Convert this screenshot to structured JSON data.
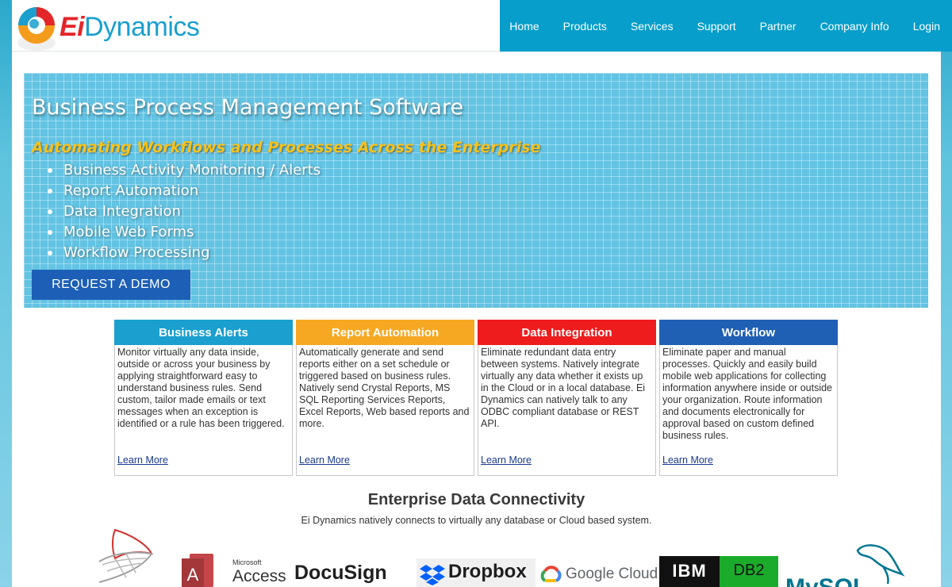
{
  "header": {
    "logo": {
      "ei": "Ei",
      "dynamics": "Dynamics"
    },
    "nav": [
      "Home",
      "Products",
      "Services",
      "Support",
      "Partner",
      "Company Info",
      "Login"
    ]
  },
  "hero": {
    "title": "Business Process Management Software",
    "subtitle": "Automating Workflows and Processes Across the Enterprise",
    "bullets": [
      "Business Activity Monitoring / Alerts",
      "Report Automation",
      "Data Integration",
      "Mobile Web Forms",
      "Workflow Processing"
    ],
    "cta": "REQUEST A DEMO"
  },
  "cards": [
    {
      "title": "Business Alerts",
      "color": "#1a9fcf",
      "body": "Monitor virtually any data inside, outside or across your business by applying straightforward easy to understand business rules.  Send custom, tailor made emails or text messages when an exception is identified or a rule has been triggered.",
      "link": "Learn More"
    },
    {
      "title": "Report Automation",
      "color": "#f7a823",
      "body": "Automatically generate and send reports either on a set schedule or triggered based on business rules. Natively send Crystal Reports, MS SQL Reporting Services Reports, Excel Reports, Web based reports and more.",
      "link": "Learn More"
    },
    {
      "title": "Data Integration",
      "color": "#ee1c1c",
      "body": "Eliminate redundant data entry between systems.  Natively integrate virtually any data whether it exists up in the Cloud or in a local database. Ei Dynamics can natively talk to any ODBC compliant database or REST API.",
      "link": "Learn More"
    },
    {
      "title": "Workflow",
      "color": "#1f5fb4",
      "body": "Eliminate paper and manual processes. Quickly and easily build mobile web applications for collecting information anywhere inside or outside your organization. Route information and documents electronically for approval based on custom defined business rules.",
      "link": "Learn More"
    }
  ],
  "connectivity": {
    "title": "Enterprise Data Connectivity",
    "subtitle": "Ei Dynamics natively connects to virtually any database or Cloud based system.",
    "logos": {
      "access_small": "Microsoft",
      "access": "Access",
      "docusign": "DocuSign",
      "dropbox": "Dropbox",
      "google_cloud": "Google Cloud",
      "ibm": "IBM",
      "db2": "DB2",
      "mysql": "MySQL"
    }
  }
}
